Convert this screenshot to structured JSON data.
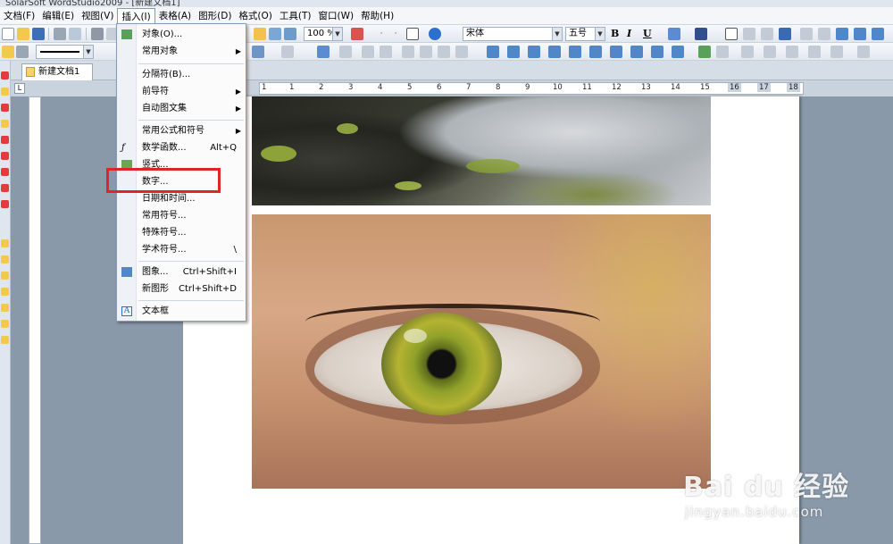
{
  "window": {
    "title": "SolarSoft WordStudio2009 - [新建文档1]"
  },
  "menubar": {
    "items": [
      "文档(F)",
      "编辑(E)",
      "视图(V)",
      "插入(I)",
      "表格(A)",
      "图形(D)",
      "格式(O)",
      "工具(T)",
      "窗口(W)",
      "帮助(H)"
    ],
    "active": "插入(I)"
  },
  "toolbar": {
    "zoom": "100 %",
    "font": "宋体",
    "size": "五号",
    "bold": "B",
    "italic": "I",
    "underline": "U"
  },
  "document_tab": {
    "label": "新建文档1"
  },
  "ruler": {
    "marks": [
      "1",
      "1",
      "2",
      "3",
      "4",
      "5",
      "6",
      "7",
      "8",
      "9",
      "10",
      "11",
      "12",
      "13",
      "14",
      "15",
      "16",
      "17",
      "18"
    ]
  },
  "insert_menu": {
    "items": [
      {
        "label": "对象(O)...",
        "shortcut": "",
        "icon": "object-icon",
        "submenu": false
      },
      {
        "label": "常用对象",
        "shortcut": "",
        "icon": "",
        "submenu": true
      },
      {
        "label": "分隔符(B)...",
        "shortcut": "",
        "icon": "",
        "submenu": false
      },
      {
        "label": "前导符",
        "shortcut": "",
        "icon": "",
        "submenu": true
      },
      {
        "label": "自动图文集",
        "shortcut": "",
        "icon": "",
        "submenu": true
      },
      {
        "label": "常用公式和符号",
        "shortcut": "",
        "icon": "",
        "submenu": true
      },
      {
        "label": "数学函数...",
        "shortcut": "Alt+Q",
        "icon": "function-icon",
        "submenu": false
      },
      {
        "label": "竖式...",
        "shortcut": "",
        "icon": "vertical-calc-icon",
        "submenu": false
      },
      {
        "label": "数字...",
        "shortcut": "",
        "icon": "",
        "submenu": false
      },
      {
        "label": "日期和时间...",
        "shortcut": "",
        "icon": "",
        "submenu": false
      },
      {
        "label": "常用符号...",
        "shortcut": "",
        "icon": "",
        "submenu": false
      },
      {
        "label": "特殊符号...",
        "shortcut": "",
        "icon": "",
        "submenu": false
      },
      {
        "label": "学术符号...",
        "shortcut": "\\",
        "icon": "",
        "submenu": false
      },
      {
        "label": "图象...",
        "shortcut": "Ctrl+Shift+I",
        "icon": "image-icon",
        "submenu": false
      },
      {
        "label": "新图形",
        "shortcut": "Ctrl+Shift+D",
        "icon": "",
        "submenu": false
      },
      {
        "label": "文本框",
        "shortcut": "",
        "icon": "textbox-icon",
        "submenu": false
      }
    ]
  },
  "highlight": {
    "target": "数字...",
    "color": "#e0252a"
  },
  "watermark": {
    "main": "Bai  du 经验",
    "sub": "jingyan.baidu.com"
  }
}
